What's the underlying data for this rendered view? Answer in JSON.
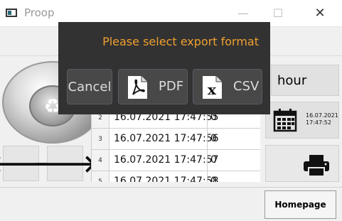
{
  "window": {
    "title": "Proop",
    "minimize": "—",
    "maximize": "☐",
    "close": "✕"
  },
  "controls": {
    "left_arrow": "🡐",
    "right_arrow": "🡒"
  },
  "table": {
    "rows": [
      {
        "num": "2",
        "time": "16.07.2021 17:47:55",
        "value": "0"
      },
      {
        "num": "3",
        "time": "16.07.2021 17:47:56",
        "value": "0"
      },
      {
        "num": "4",
        "time": "16.07.2021 17:47:57",
        "value": "0"
      },
      {
        "num": "5",
        "time": "16.07.2021 17:47:58",
        "value": "0"
      }
    ]
  },
  "right_panel": {
    "interval": "hour",
    "date_line1": "16.07.2021",
    "date_line2": "17:47:52",
    "homepage": "Homepage"
  },
  "dialog": {
    "title": "Please select export format",
    "cancel": "Cancel",
    "pdf": "PDF",
    "csv": "CSV"
  },
  "colors": {
    "dialog_bg": "#323232",
    "dialog_title": "#f0a030",
    "button_text": "#dddddd"
  }
}
